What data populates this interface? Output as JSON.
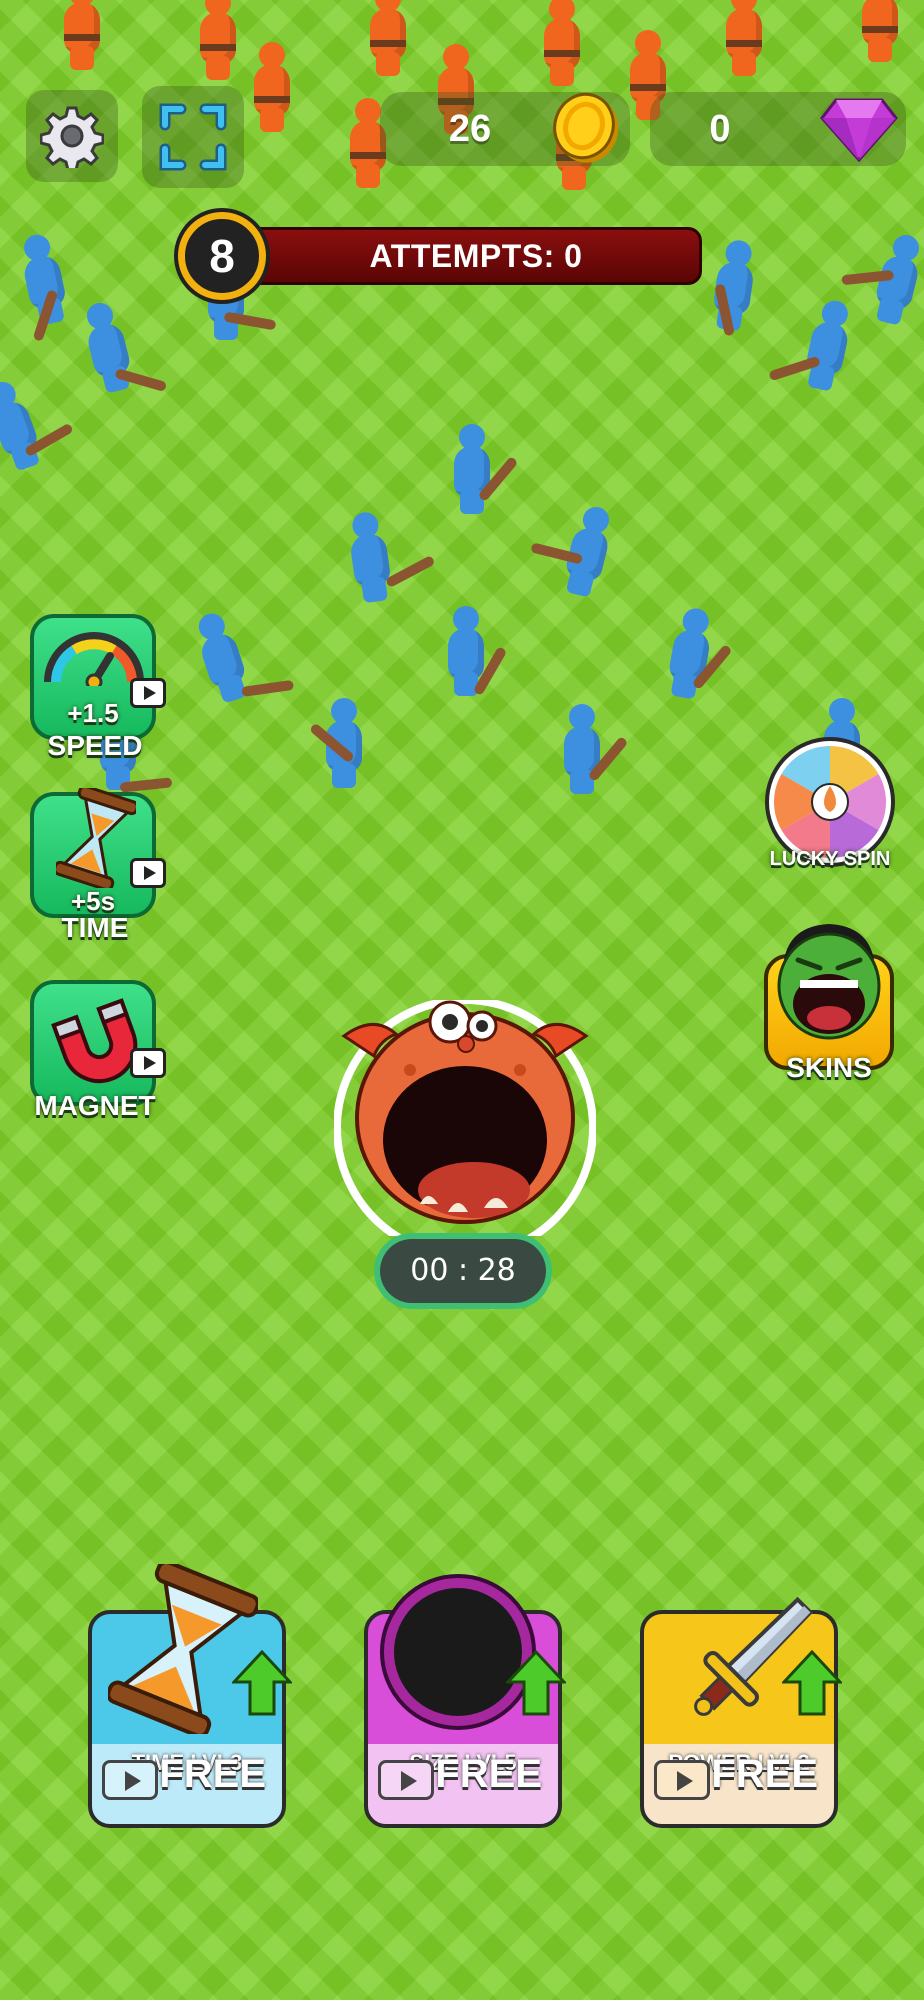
{
  "topbar": {
    "settings_icon": "gear-icon",
    "fullscreen_icon": "fullscreen-icon",
    "coins": "26",
    "coin_icon": "coin-icon",
    "gems": "0",
    "gem_icon": "gem-icon"
  },
  "level": {
    "number": "8",
    "attempts_label": "ATTEMPTS: 0"
  },
  "boosters": [
    {
      "value": "+1.5",
      "label": "SPEED",
      "icon": "speedometer-icon"
    },
    {
      "value": "+5s",
      "label": "TIME",
      "icon": "hourglass-icon"
    },
    {
      "value": "",
      "label": "MAGNET",
      "icon": "magnet-icon"
    }
  ],
  "side_buttons": {
    "lucky_spin": "LUCKY SPIN",
    "skins": "SKINS"
  },
  "timer": "00 : 28",
  "upgrades": [
    {
      "title": "TIME LVL3",
      "cta": "FREE",
      "color": "#4cc8e8"
    },
    {
      "title": "SIZE LVL5",
      "cta": "FREE",
      "color": "#d94ed8"
    },
    {
      "title": "POWER LVL2",
      "cta": "FREE",
      "color": "#f7c61a"
    }
  ],
  "colors": {
    "grass": "#7fd12a",
    "blue_team": "#3d8fe0",
    "orange_team": "#f0661e",
    "attempts_bar": "#7a0a0a",
    "level_ring": "#f3b10f"
  }
}
